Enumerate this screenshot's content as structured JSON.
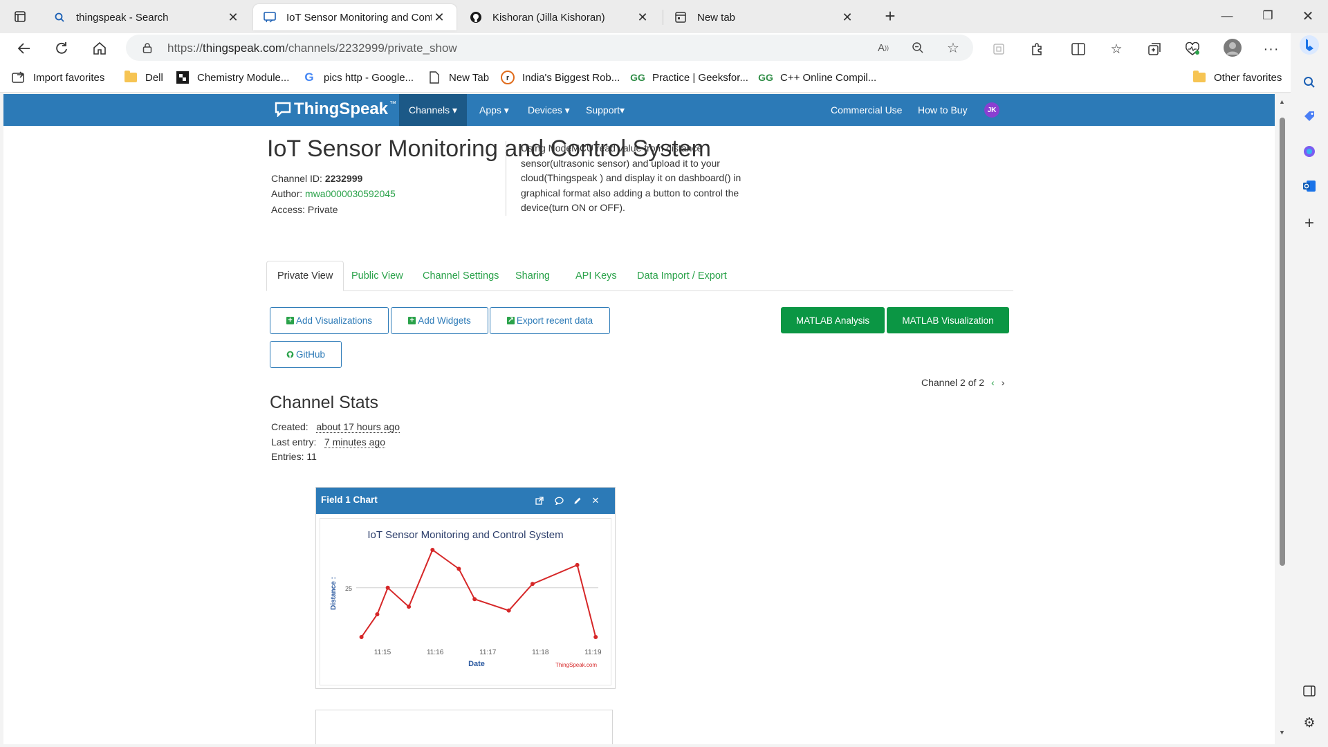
{
  "browser": {
    "tabs": [
      {
        "title": "thingspeak - Search",
        "icon": "search-icon"
      },
      {
        "title": "IoT Sensor Monitoring and Contr",
        "icon": "monitor-icon"
      },
      {
        "title": "Kishoran (Jilla Kishoran)",
        "icon": "github-icon"
      },
      {
        "title": "New tab",
        "icon": "newtab-icon"
      }
    ],
    "url_prefix": "https://",
    "url_host": "thingspeak.com",
    "url_path": "/channels/2232999/private_show",
    "favorites": [
      {
        "label": "Import favorites",
        "icon": "import-icon"
      },
      {
        "label": "Dell",
        "icon": "folder-icon"
      },
      {
        "label": "Chemistry Module...",
        "icon": "chemistry-icon"
      },
      {
        "label": "pics http - Google...",
        "icon": "google-icon"
      },
      {
        "label": "New Tab",
        "icon": "page-icon"
      },
      {
        "label": "India's Biggest Rob...",
        "icon": "robu-icon"
      },
      {
        "label": "Practice | Geeksfor...",
        "icon": "gfg-icon"
      },
      {
        "label": "C++ Online Compil...",
        "icon": "gfg-icon"
      },
      {
        "label": "Other favorites",
        "icon": "folder-icon"
      }
    ]
  },
  "nav": {
    "logo": "ThingSpeak",
    "logo_tm": "™",
    "menu": [
      "Channels",
      "Apps",
      "Devices",
      "Support"
    ],
    "right": [
      "Commercial Use",
      "How to Buy"
    ],
    "avatar": "JK"
  },
  "channel": {
    "title": "IoT Sensor Monitoring and Control System",
    "id_label": "Channel ID:",
    "id": "2232999",
    "author_label": "Author:",
    "author": "mwa0000030592045",
    "access": "Access: Private",
    "description": "Using NodeMCU read value from distance sensor(ultrasonic sensor) and upload it to your cloud(Thingspeak ) and display it on dashboard() in graphical format also adding a button to control the device(turn ON or OFF)."
  },
  "tabs": [
    "Private View",
    "Public View",
    "Channel Settings",
    "Sharing",
    "API Keys",
    "Data Import / Export"
  ],
  "buttons": {
    "add_visualizations": "Add Visualizations",
    "add_widgets": "Add Widgets",
    "export": "Export recent data",
    "github": "GitHub",
    "matlab_analysis": "MATLAB Analysis",
    "matlab_visualization": "MATLAB Visualization"
  },
  "pager": "Channel 2 of 2",
  "stats": {
    "heading": "Channel Stats",
    "created_label": "Created:",
    "created": "about 17 hours ago",
    "last_label": "Last entry:",
    "last": "7 minutes ago",
    "entries": "Entries: 11"
  },
  "widget": {
    "title": "Field 1 Chart"
  },
  "chart_data": {
    "type": "line",
    "title": "IoT Sensor Monitoring and Control System",
    "xlabel": "Date",
    "ylabel": "Distance :",
    "credit": "ThingSpeak.com",
    "x_ticks": [
      "11:15",
      "11:16",
      "11:17",
      "11:18",
      "11:19"
    ],
    "y_ticks": [
      25
    ],
    "series_color": "#d62728",
    "x_minutes": [
      14.6,
      14.9,
      15.1,
      15.5,
      15.95,
      16.45,
      16.75,
      17.4,
      17.85,
      18.7,
      19.05
    ],
    "values": [
      12,
      18,
      25,
      20,
      35,
      30,
      22,
      19,
      26,
      31,
      12
    ],
    "xlim": [
      14.5,
      19.1
    ],
    "ylim": [
      10,
      37
    ]
  }
}
